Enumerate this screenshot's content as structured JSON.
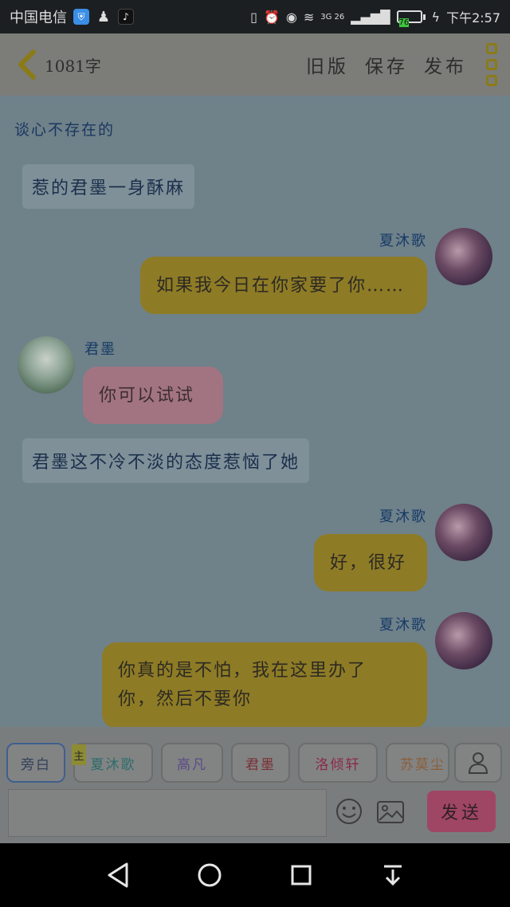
{
  "status_bar": {
    "carrier": "中国电信",
    "network": "3G 26",
    "battery_level": "76",
    "time": "下午2:57"
  },
  "header": {
    "word_count": "1081字",
    "actions": [
      "旧版",
      "保存",
      "发布"
    ]
  },
  "chat": {
    "topic": "谈心不存在的",
    "messages": [
      {
        "type": "narration",
        "text": "惹的君墨一身酥麻"
      },
      {
        "type": "bubble",
        "side": "right",
        "sender": "夏沐歌",
        "text": "如果我今日在你家要了你……"
      },
      {
        "type": "bubble",
        "side": "left",
        "sender": "君墨",
        "text": "你可以试试"
      },
      {
        "type": "narration",
        "text": "君墨这不冷不淡的态度惹恼了她"
      },
      {
        "type": "bubble",
        "side": "right",
        "sender": "夏沐歌",
        "text": "好，很好"
      },
      {
        "type": "bubble",
        "side": "right",
        "sender": "夏沐歌",
        "text_line1": "你真的是不怕，我在这里办了",
        "text_line2": "你，然后不要你"
      }
    ]
  },
  "composer": {
    "roles": [
      {
        "label": "旁白",
        "color": "#33405a"
      },
      {
        "label": "夏沐歌",
        "color": "#2f6b6b"
      },
      {
        "label": "高凡",
        "color": "#5b4a86"
      },
      {
        "label": "君墨",
        "color": "#7b2f34"
      },
      {
        "label": "洛倾轩",
        "color": "#8b2a49"
      },
      {
        "label": "苏莫尘",
        "color": "#8a5e3a"
      }
    ],
    "main_tag": "主",
    "input_placeholder": "",
    "send_label": "发送"
  }
}
